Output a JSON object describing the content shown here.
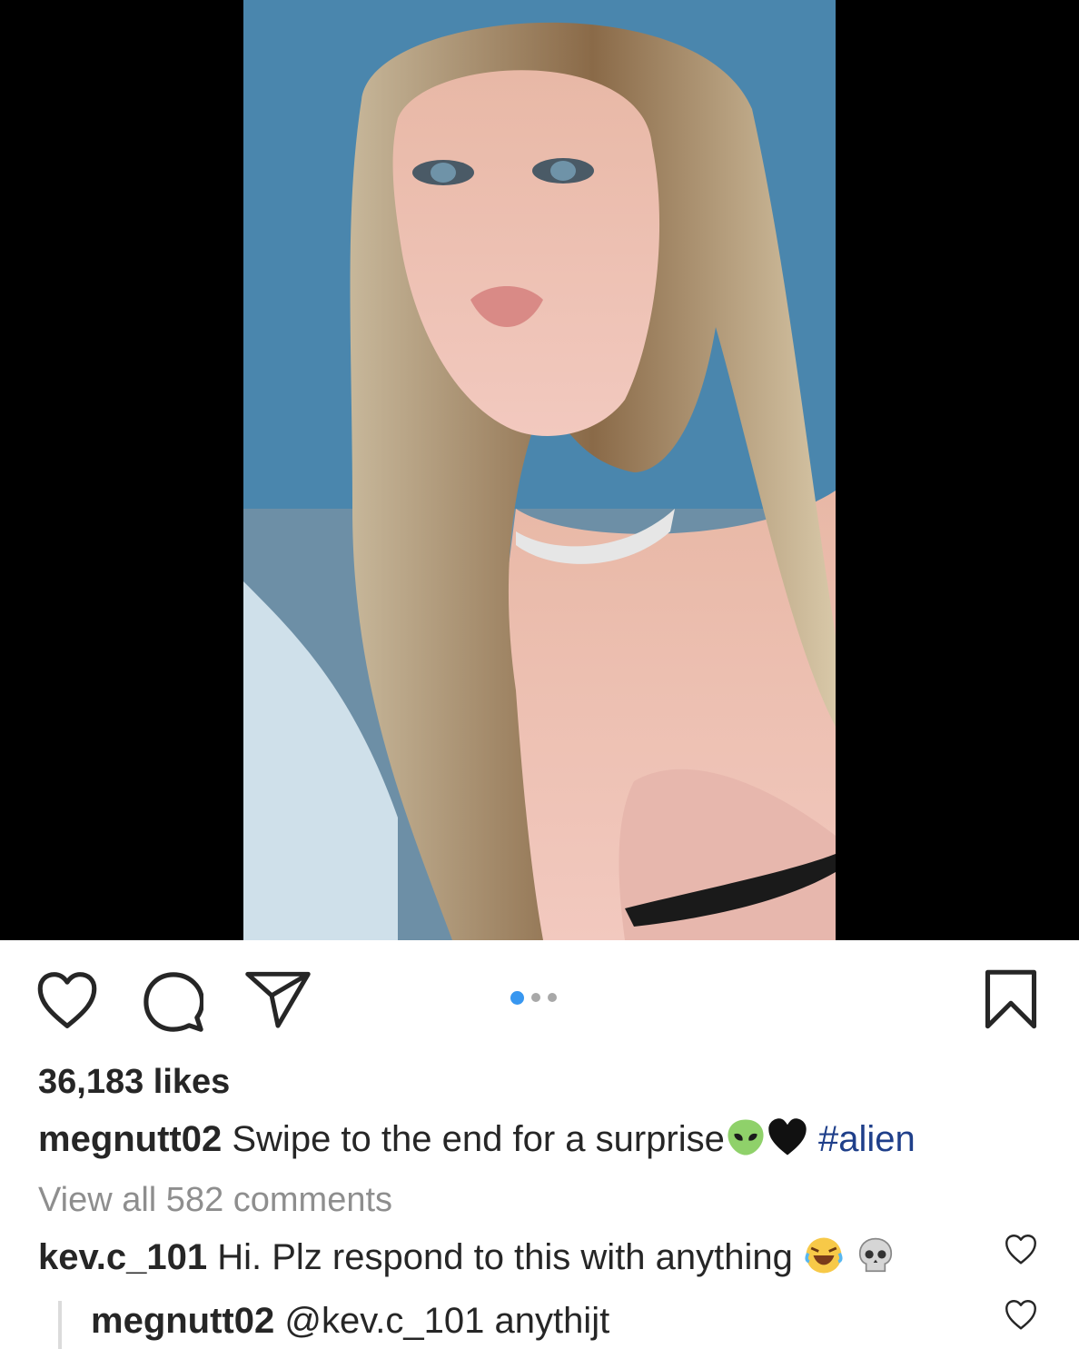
{
  "post": {
    "media": {
      "description_icon": "photo",
      "carousel_dots": 3,
      "active_dot": 0,
      "active_dot_color": "#3897f0"
    },
    "actions": {
      "like_icon": "heart-icon",
      "comment_icon": "comment-icon",
      "share_icon": "paper-plane-icon",
      "save_icon": "bookmark-icon"
    },
    "likes": "36,183 likes",
    "caption": {
      "username": "megnutt02",
      "text": " Swipe to the end for a surprise",
      "hashtag": "#alien"
    },
    "view_all_comments": "View all 582 comments",
    "comments": [
      {
        "username": "kev.c_101",
        "text": " Hi. Plz respond to this with anything "
      }
    ],
    "replies": [
      {
        "username": "megnutt02",
        "text": " @kev.c_101 anythijt"
      }
    ]
  }
}
